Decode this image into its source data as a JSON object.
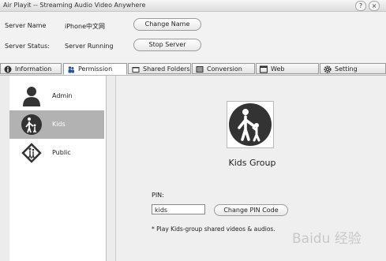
{
  "window": {
    "title": "Air Playit -- Streaming Audio Video Anywhere",
    "help_glyph": "?",
    "close_glyph": "×"
  },
  "header": {
    "server_name_label": "Server Name",
    "server_name_value": "iPhone中文网",
    "change_name_button": "Change Name",
    "server_status_label": "Server Status:",
    "server_status_value": "Server Running",
    "stop_server_button": "Stop Server"
  },
  "tabs": [
    {
      "label": "Information",
      "icon": "info-icon"
    },
    {
      "label": "Permission",
      "icon": "user-icon",
      "active": true
    },
    {
      "label": "Shared Folders",
      "icon": "folder-icon"
    },
    {
      "label": "Conversion",
      "icon": "conversion-icon"
    },
    {
      "label": "Web",
      "icon": "web-icon"
    },
    {
      "label": "Setting",
      "icon": "gear-icon"
    }
  ],
  "sidebar": {
    "items": [
      {
        "label": "Admin",
        "icon": "admin-user-icon"
      },
      {
        "label": "Kids",
        "icon": "kids-icon",
        "selected": true
      },
      {
        "label": "Public",
        "icon": "public-icon"
      }
    ]
  },
  "main": {
    "group_title": "Kids Group",
    "pin_label": "PIN:",
    "pin_value": "kids",
    "change_pin_button": "Change PIN Code",
    "note": "* Play Kids-group shared videos & audios."
  },
  "watermark": "Baidu 经验",
  "colors": {
    "selected_item": "#b2b2b2",
    "icon_dark": "#333333"
  }
}
